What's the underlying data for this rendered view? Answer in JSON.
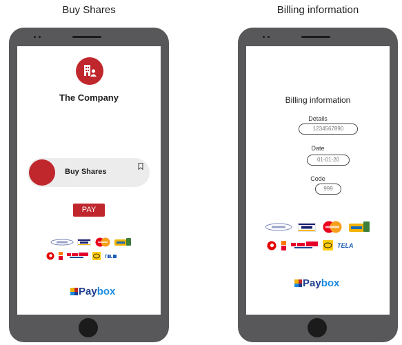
{
  "left_screen": {
    "caption": "Buy Shares",
    "company_name": "The Company",
    "buy_card_label": "Buy Shares",
    "pay_button": "PAY",
    "payment_logos": [
      {
        "name": "airtel-money-logo",
        "color": "#cfd3e6"
      },
      {
        "name": "visa-logo",
        "color": "#1a1f71"
      },
      {
        "name": "mastercard-logo",
        "color": "#eb001b"
      },
      {
        "name": "moov-money-logo",
        "color": "#f2b200"
      },
      {
        "name": "vodafone-logo",
        "color": "#e60000"
      },
      {
        "name": "airtel-tigo-logo",
        "color": "#e4002b"
      },
      {
        "name": "mtn-logo",
        "color": "#ffcb05"
      },
      {
        "name": "tela-logo",
        "color": "#1a5bb5"
      }
    ],
    "paybox_pay": "Pay",
    "paybox_box": "box"
  },
  "right_screen": {
    "caption": "Billing information",
    "title": "Billing information",
    "details_label": "Details",
    "details_value": "1234567890",
    "date_label": "Date",
    "date_value": "01-01-20",
    "code_label": "Code",
    "code_value": "999",
    "tela_text": "TELA",
    "paybox_pay": "Pay",
    "paybox_box": "box"
  },
  "colors": {
    "brand_red": "#c0272d",
    "phone_body": "#58585a",
    "paybox_dark": "#1f3f8f",
    "paybox_light": "#1b8be0"
  }
}
